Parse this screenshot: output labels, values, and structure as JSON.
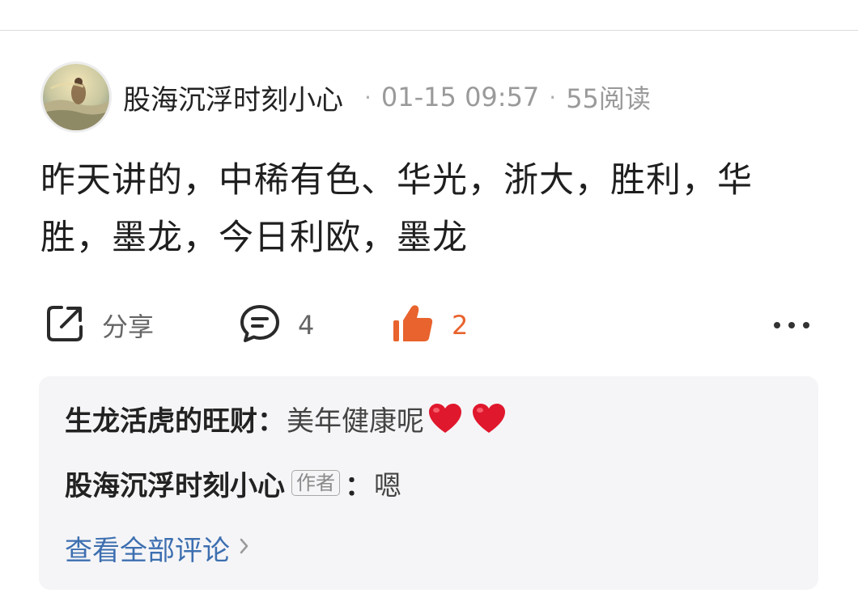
{
  "post": {
    "author": "股海沉浮时刻小心",
    "timestamp": "01-15 09:57",
    "reads": "55阅读",
    "content": "昨天讲的，中稀有色、华光，浙大，胜利，华胜，墨龙，今日利欧，墨龙"
  },
  "actions": {
    "share_label": "分享",
    "comment_count": "4",
    "like_count": "2"
  },
  "comments": [
    {
      "user": "生龙活虎的旺财",
      "text": "美年健康呢"
    },
    {
      "user": "股海沉浮时刻小心",
      "badge": "作者",
      "text": "嗯"
    }
  ],
  "view_all_label": "查看全部评论",
  "colors": {
    "like_accent": "#e8632d",
    "link": "#3d6fb0",
    "comment_bg": "#f5f5f7",
    "heart": "#e0182d"
  },
  "icons": {
    "share": "share-icon",
    "comment": "comment-icon",
    "like": "thumbs-up-icon",
    "more": "more-icon",
    "heart": "heart-icon",
    "chevron": "chevron-right-icon"
  }
}
